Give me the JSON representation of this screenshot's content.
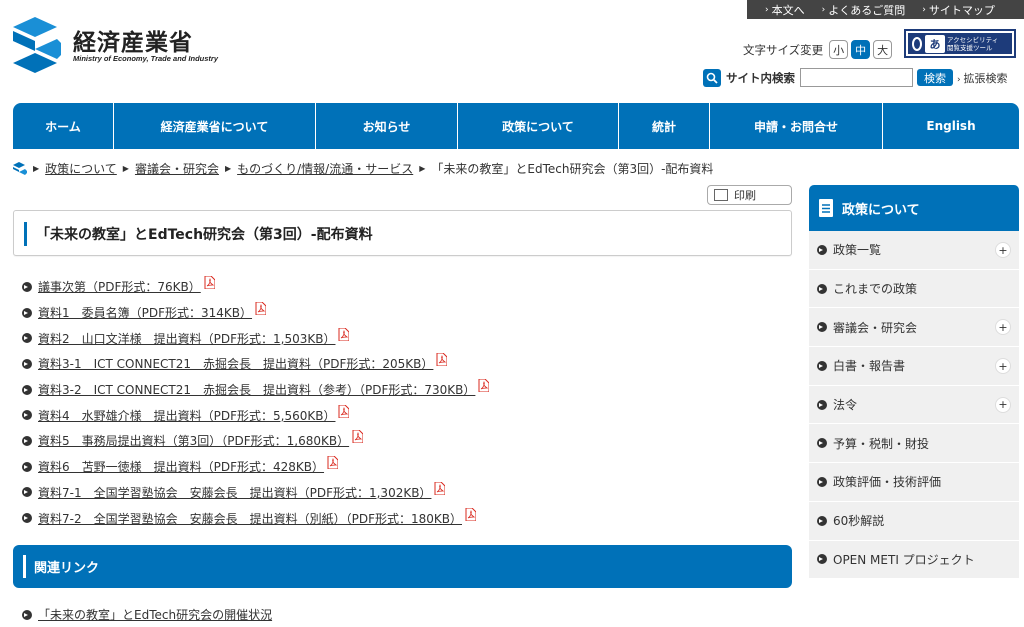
{
  "utility": {
    "items": [
      {
        "label": "本文へ"
      },
      {
        "label": "よくあるご質問"
      },
      {
        "label": "サイトマップ"
      }
    ]
  },
  "logo": {
    "name_ja": "経済産業省",
    "name_en": "Ministry of Economy, Trade and Industry"
  },
  "font_size": {
    "label": "文字サイズ変更",
    "options": [
      "小",
      "中",
      "大"
    ],
    "selected": "中"
  },
  "accessibility": {
    "icon_text": "あ",
    "line1": "アクセシビリティ",
    "line2": "閲覧支援ツール"
  },
  "search": {
    "label": "サイト内検索",
    "value": "",
    "button": "検索",
    "advanced": "拡張検索"
  },
  "nav": {
    "items": [
      {
        "label": "ホーム"
      },
      {
        "label": "経済産業省について"
      },
      {
        "label": "お知らせ"
      },
      {
        "label": "政策について"
      },
      {
        "label": "統計"
      },
      {
        "label": "申請・お問合せ"
      },
      {
        "label": "English"
      }
    ]
  },
  "breadcrumb": {
    "items": [
      {
        "label": "政策について"
      },
      {
        "label": "審議会・研究会"
      },
      {
        "label": "ものづくり/情報/流通・サービス"
      }
    ],
    "current": "「未来の教室」とEdTech研究会（第3回）-配布資料"
  },
  "print": {
    "label": "印刷"
  },
  "page": {
    "title": "「未来の教室」とEdTech研究会（第3回）-配布資料"
  },
  "documents": [
    {
      "label": "議事次第（PDF形式：76KB）"
    },
    {
      "label": "資料1　委員名簿（PDF形式：314KB）"
    },
    {
      "label": "資料2　山口文洋様　提出資料（PDF形式：1,503KB）"
    },
    {
      "label": "資料3-1　ICT CONNECT21　赤掘会長　提出資料（PDF形式：205KB）"
    },
    {
      "label": "資料3-2　ICT CONNECT21　赤掘会長　提出資料（参考）（PDF形式：730KB）"
    },
    {
      "label": "資料4　水野雄介様　提出資料（PDF形式：5,560KB）"
    },
    {
      "label": "資料5　事務局提出資料（第3回）（PDF形式：1,680KB）"
    },
    {
      "label": "資料6　苫野一徳様　提出資料（PDF形式：428KB）"
    },
    {
      "label": "資料7-1　全国学習塾協会　安藤会長　提出資料（PDF形式：1,302KB）"
    },
    {
      "label": "資料7-2　全国学習塾協会　安藤会長　提出資料（別紙）（PDF形式：180KB）"
    }
  ],
  "related": {
    "heading": "関連リンク",
    "links": [
      {
        "label": "「未来の教室」とEdTech研究会の開催状況"
      }
    ]
  },
  "sidebar": {
    "heading": "政策について",
    "items": [
      {
        "label": "政策一覧",
        "expand": "+"
      },
      {
        "label": "これまでの政策",
        "expand": ""
      },
      {
        "label": "審議会・研究会",
        "expand": "+"
      },
      {
        "label": "白書・報告書",
        "expand": "+"
      },
      {
        "label": "法令",
        "expand": "+"
      },
      {
        "label": "予算・税制・財投",
        "expand": ""
      },
      {
        "label": "政策評価・技術評価",
        "expand": ""
      },
      {
        "label": "60秒解説",
        "expand": ""
      },
      {
        "label": "OPEN METI プロジェクト",
        "expand": ""
      }
    ]
  },
  "colors": {
    "brand_blue": "#0071b8",
    "dark_bar": "#444444",
    "sidebar_bg": "#f0f0f0",
    "pdf_red": "#d9281e"
  }
}
